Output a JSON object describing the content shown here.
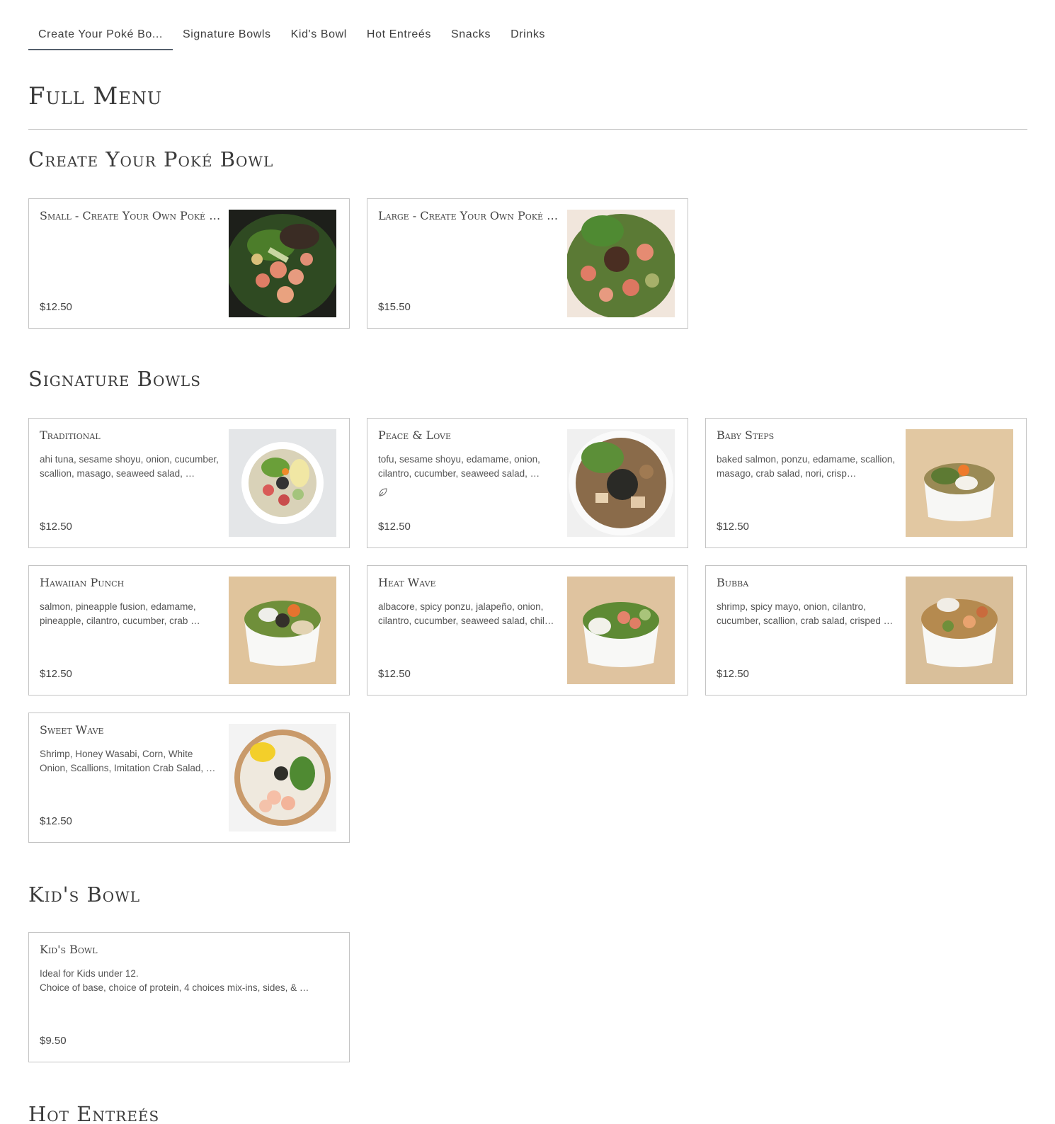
{
  "tabs": [
    {
      "label": "Create Your Poké Bo..."
    },
    {
      "label": "Signature Bowls"
    },
    {
      "label": "Kid's Bowl"
    },
    {
      "label": "Hot Entreés"
    },
    {
      "label": "Snacks"
    },
    {
      "label": "Drinks"
    }
  ],
  "page_title": "Full Menu",
  "sections": {
    "create": {
      "title": "Create Your Poké Bowl",
      "items": [
        {
          "name": "Small - Create Your Own Poké Bowl",
          "price": "$12.50"
        },
        {
          "name": "Large - Create Your Own Poké Bowl",
          "price": "$15.50"
        }
      ]
    },
    "signature": {
      "title": "Signature Bowls",
      "items": [
        {
          "name": "Traditional",
          "desc": "ahi tuna, sesame shoyu, onion, cucumber, scallion, masago, seaweed salad, …",
          "price": "$12.50"
        },
        {
          "name": "Peace & Love",
          "desc": "tofu, sesame shoyu, edamame, onion, cilantro, cucumber, seaweed salad, …",
          "badge": "vegan-leaf-icon",
          "price": "$12.50"
        },
        {
          "name": "Baby Steps",
          "desc": "baked salmon, ponzu, edamame, scallion, masago, crab salad, nori, crisp…",
          "price": "$12.50"
        },
        {
          "name": "Hawaiian Punch",
          "desc": "salmon, pineapple fusion, edamame, pineapple, cilantro, cucumber, crab …",
          "price": "$12.50"
        },
        {
          "name": "Heat Wave",
          "desc": "albacore, spicy ponzu, jalapeño, onion, cilantro, cucumber, seaweed salad, chil…",
          "price": "$12.50"
        },
        {
          "name": "Bubba",
          "desc": "shrimp, spicy mayo, onion, cilantro, cucumber, scallion, crab salad, crisped …",
          "price": "$12.50"
        },
        {
          "name": "Sweet Wave",
          "desc": "Shrimp, Honey Wasabi, Corn, White Onion, Scallions, Imitation Crab Salad, …",
          "price": "$12.50"
        }
      ]
    },
    "kids": {
      "title": "Kid's Bowl",
      "items": [
        {
          "name": "Kid's Bowl",
          "desc_line1": "Ideal for Kids under 12.",
          "desc_line2": "Choice of base, choice of protein, 4 choices mix-ins, sides, & …",
          "price": "$9.50"
        }
      ]
    },
    "hot": {
      "title": "Hot Entreés"
    }
  },
  "colors": {
    "border": "#c4c4c4",
    "text": "#3a3a3a",
    "tab_underline": "#55606c"
  }
}
